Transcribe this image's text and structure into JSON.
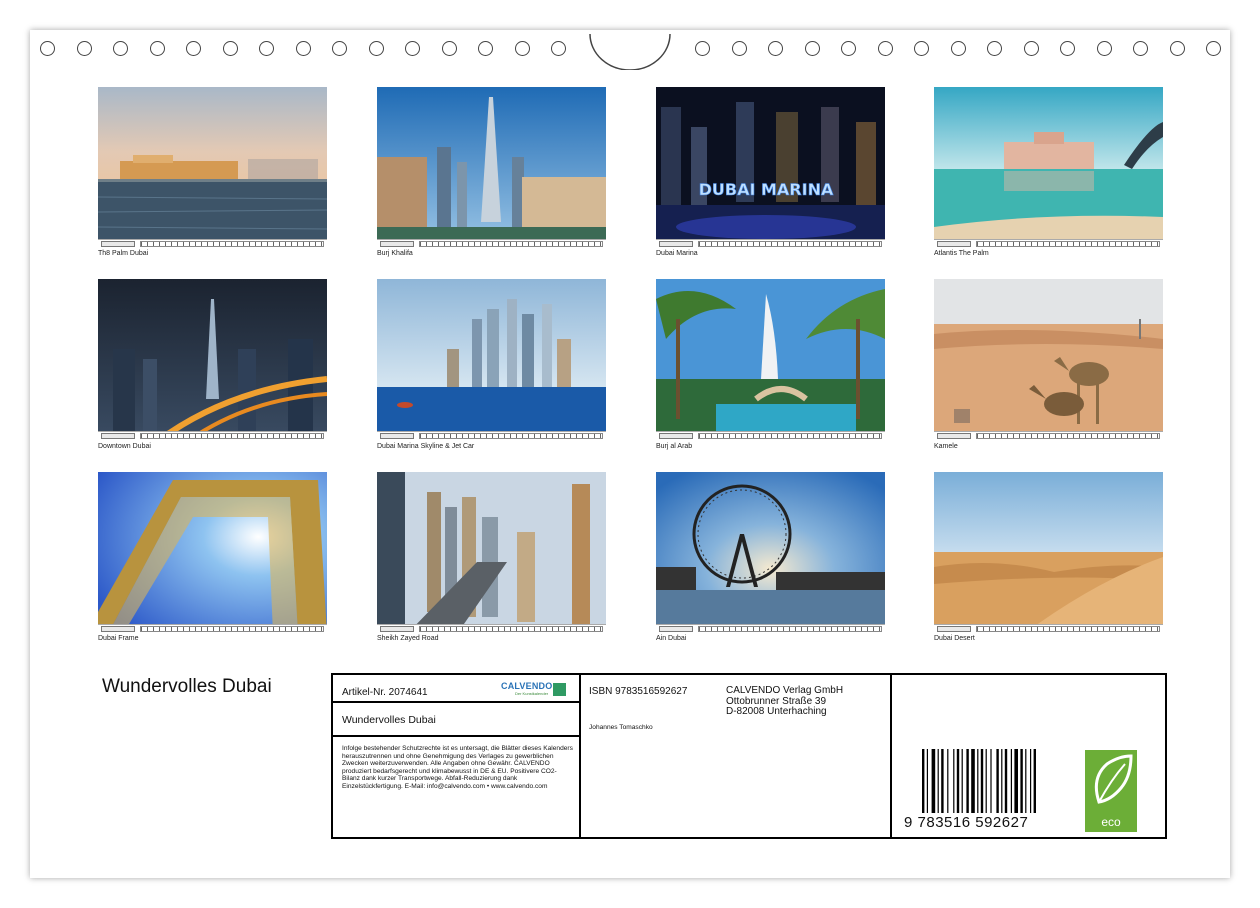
{
  "photos": [
    {
      "caption": "Th8 Palm Dubai",
      "month": "Januar 2025"
    },
    {
      "caption": "Burj Khalifa",
      "month": "Februar 2025"
    },
    {
      "caption": "Dubai Marina",
      "month": "März 2025"
    },
    {
      "caption": "Atlantis The Palm",
      "month": "April 2025"
    },
    {
      "caption": "Downtown Dubai",
      "month": "Mai 2025"
    },
    {
      "caption": "Dubai Marina Skyline & Jet Car",
      "month": "Juni 2025"
    },
    {
      "caption": "Burj al Arab",
      "month": "Juli 2025"
    },
    {
      "caption": "Kamele",
      "month": "August 2025"
    },
    {
      "caption": "Dubai Frame",
      "month": "September 2025"
    },
    {
      "caption": "Sheikh Zayed Road",
      "month": "Oktober 2025"
    },
    {
      "caption": "Ain Dubai",
      "month": "November 2025"
    },
    {
      "caption": "Dubai Desert",
      "month": "Dezember 2025"
    }
  ],
  "marina_sign": "DUBAI MARINA",
  "title": "Wundervolles Dubai",
  "info": {
    "article": "Artikel-Nr. 2074641",
    "brand": "CALVENDO",
    "brand_tagline": "Der Kunstkalender",
    "subtitle": "Wundervolles Dubai",
    "legal": "Infolge bestehender Schutzrechte ist es untersagt, die Blätter dieses Kalenders herauszutrennen und ohne Genehmigung des Verlages zu gewerblichen Zwecken weiterzuverwenden. Alle Angaben ohne Gewähr. CALVENDO produziert bedarfsgerecht und klimabewusst in DE & EU. Positivere CO2-Bilanz dank kurzer Transportwege. Abfall-Reduzierung dank Einzelstückfertigung. E-Mail: info@calvendo.com • www.calvendo.com",
    "isbn": "ISBN 9783516592627",
    "author": "Johannes Tomaschko",
    "publisher_lines": [
      "CALVENDO Verlag GmbH",
      "Ottobrunner Straße 39",
      "D-82008 Unterhaching"
    ],
    "barcode_number": "9 783516 592627",
    "eco_label": "eco"
  },
  "colors": {
    "eco_green": "#6cae37",
    "calvendo_blue": "#2a73b7"
  }
}
